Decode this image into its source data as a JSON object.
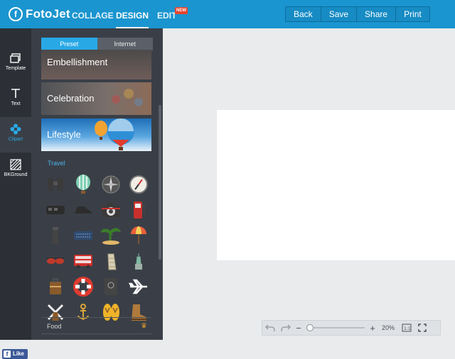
{
  "app": {
    "logo_text": "FotoJet",
    "nav": [
      {
        "label": "COLLAGE"
      },
      {
        "label": "DESIGN",
        "active": true
      },
      {
        "label": "EDIT",
        "badge": "NEW"
      }
    ],
    "actions": [
      "Back",
      "Save",
      "Share",
      "Print"
    ],
    "accent_color": "#1a95cf"
  },
  "left_nav": [
    {
      "label": "Template",
      "icon": "template-icon"
    },
    {
      "label": "Text",
      "icon": "text-icon"
    },
    {
      "label": "Clipart",
      "icon": "flower-icon",
      "active": true
    },
    {
      "label": "BKGround",
      "icon": "background-icon"
    }
  ],
  "facebook": {
    "label": "Like"
  },
  "panel": {
    "tabs": [
      {
        "label": "Preset",
        "active": true
      },
      {
        "label": "Internet"
      }
    ],
    "categories": [
      "Embellishment",
      "Celebration",
      "Lifestyle"
    ],
    "section_label": "Travel",
    "clipart_icons": [
      "binoculars-icon",
      "hot-air-balloon-icon",
      "compass-rose-icon",
      "compass-icon",
      "train-icon",
      "hiking-boot-icon",
      "camera-icon",
      "fuel-pump-icon",
      "lighthouse-icon",
      "keyboard-icon",
      "palm-tree-island-icon",
      "beach-umbrella-icon",
      "sunglasses-icon",
      "double-decker-bus-icon",
      "leaning-tower-icon",
      "statue-of-liberty-icon",
      "suitcase-icon",
      "life-ring-icon",
      "passport-icon",
      "airplane-icon",
      "windmill-icon",
      "anchor-icon",
      "flip-flops-icon",
      "boot-icon"
    ],
    "next_section": "Food"
  },
  "zoom": {
    "value": "20%"
  }
}
